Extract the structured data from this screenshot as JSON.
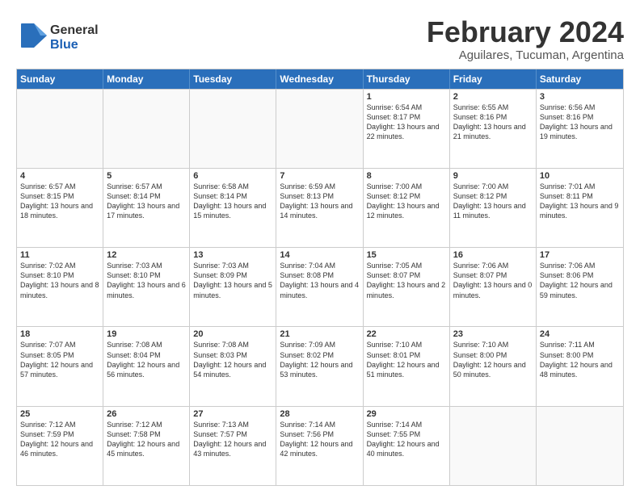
{
  "logo": {
    "line1": "General",
    "line2": "Blue"
  },
  "header": {
    "month_year": "February 2024",
    "location": "Aguilares, Tucuman, Argentina"
  },
  "day_headers": [
    "Sunday",
    "Monday",
    "Tuesday",
    "Wednesday",
    "Thursday",
    "Friday",
    "Saturday"
  ],
  "rows": [
    [
      {
        "date": "",
        "empty": true
      },
      {
        "date": "",
        "empty": true
      },
      {
        "date": "",
        "empty": true
      },
      {
        "date": "",
        "empty": true
      },
      {
        "date": "1",
        "sunrise": "6:54 AM",
        "sunset": "8:17 PM",
        "daylight": "13 hours and 22 minutes."
      },
      {
        "date": "2",
        "sunrise": "6:55 AM",
        "sunset": "8:16 PM",
        "daylight": "13 hours and 21 minutes."
      },
      {
        "date": "3",
        "sunrise": "6:56 AM",
        "sunset": "8:16 PM",
        "daylight": "13 hours and 19 minutes."
      }
    ],
    [
      {
        "date": "4",
        "sunrise": "6:57 AM",
        "sunset": "8:15 PM",
        "daylight": "13 hours and 18 minutes."
      },
      {
        "date": "5",
        "sunrise": "6:57 AM",
        "sunset": "8:14 PM",
        "daylight": "13 hours and 17 minutes."
      },
      {
        "date": "6",
        "sunrise": "6:58 AM",
        "sunset": "8:14 PM",
        "daylight": "13 hours and 15 minutes."
      },
      {
        "date": "7",
        "sunrise": "6:59 AM",
        "sunset": "8:13 PM",
        "daylight": "13 hours and 14 minutes."
      },
      {
        "date": "8",
        "sunrise": "7:00 AM",
        "sunset": "8:12 PM",
        "daylight": "13 hours and 12 minutes."
      },
      {
        "date": "9",
        "sunrise": "7:00 AM",
        "sunset": "8:12 PM",
        "daylight": "13 hours and 11 minutes."
      },
      {
        "date": "10",
        "sunrise": "7:01 AM",
        "sunset": "8:11 PM",
        "daylight": "13 hours and 9 minutes."
      }
    ],
    [
      {
        "date": "11",
        "sunrise": "7:02 AM",
        "sunset": "8:10 PM",
        "daylight": "13 hours and 8 minutes."
      },
      {
        "date": "12",
        "sunrise": "7:03 AM",
        "sunset": "8:10 PM",
        "daylight": "13 hours and 6 minutes."
      },
      {
        "date": "13",
        "sunrise": "7:03 AM",
        "sunset": "8:09 PM",
        "daylight": "13 hours and 5 minutes."
      },
      {
        "date": "14",
        "sunrise": "7:04 AM",
        "sunset": "8:08 PM",
        "daylight": "13 hours and 4 minutes."
      },
      {
        "date": "15",
        "sunrise": "7:05 AM",
        "sunset": "8:07 PM",
        "daylight": "13 hours and 2 minutes."
      },
      {
        "date": "16",
        "sunrise": "7:06 AM",
        "sunset": "8:07 PM",
        "daylight": "13 hours and 0 minutes."
      },
      {
        "date": "17",
        "sunrise": "7:06 AM",
        "sunset": "8:06 PM",
        "daylight": "12 hours and 59 minutes."
      }
    ],
    [
      {
        "date": "18",
        "sunrise": "7:07 AM",
        "sunset": "8:05 PM",
        "daylight": "12 hours and 57 minutes."
      },
      {
        "date": "19",
        "sunrise": "7:08 AM",
        "sunset": "8:04 PM",
        "daylight": "12 hours and 56 minutes."
      },
      {
        "date": "20",
        "sunrise": "7:08 AM",
        "sunset": "8:03 PM",
        "daylight": "12 hours and 54 minutes."
      },
      {
        "date": "21",
        "sunrise": "7:09 AM",
        "sunset": "8:02 PM",
        "daylight": "12 hours and 53 minutes."
      },
      {
        "date": "22",
        "sunrise": "7:10 AM",
        "sunset": "8:01 PM",
        "daylight": "12 hours and 51 minutes."
      },
      {
        "date": "23",
        "sunrise": "7:10 AM",
        "sunset": "8:00 PM",
        "daylight": "12 hours and 50 minutes."
      },
      {
        "date": "24",
        "sunrise": "7:11 AM",
        "sunset": "8:00 PM",
        "daylight": "12 hours and 48 minutes."
      }
    ],
    [
      {
        "date": "25",
        "sunrise": "7:12 AM",
        "sunset": "7:59 PM",
        "daylight": "12 hours and 46 minutes."
      },
      {
        "date": "26",
        "sunrise": "7:12 AM",
        "sunset": "7:58 PM",
        "daylight": "12 hours and 45 minutes."
      },
      {
        "date": "27",
        "sunrise": "7:13 AM",
        "sunset": "7:57 PM",
        "daylight": "12 hours and 43 minutes."
      },
      {
        "date": "28",
        "sunrise": "7:14 AM",
        "sunset": "7:56 PM",
        "daylight": "12 hours and 42 minutes."
      },
      {
        "date": "29",
        "sunrise": "7:14 AM",
        "sunset": "7:55 PM",
        "daylight": "12 hours and 40 minutes."
      },
      {
        "date": "",
        "empty": true
      },
      {
        "date": "",
        "empty": true
      }
    ]
  ]
}
